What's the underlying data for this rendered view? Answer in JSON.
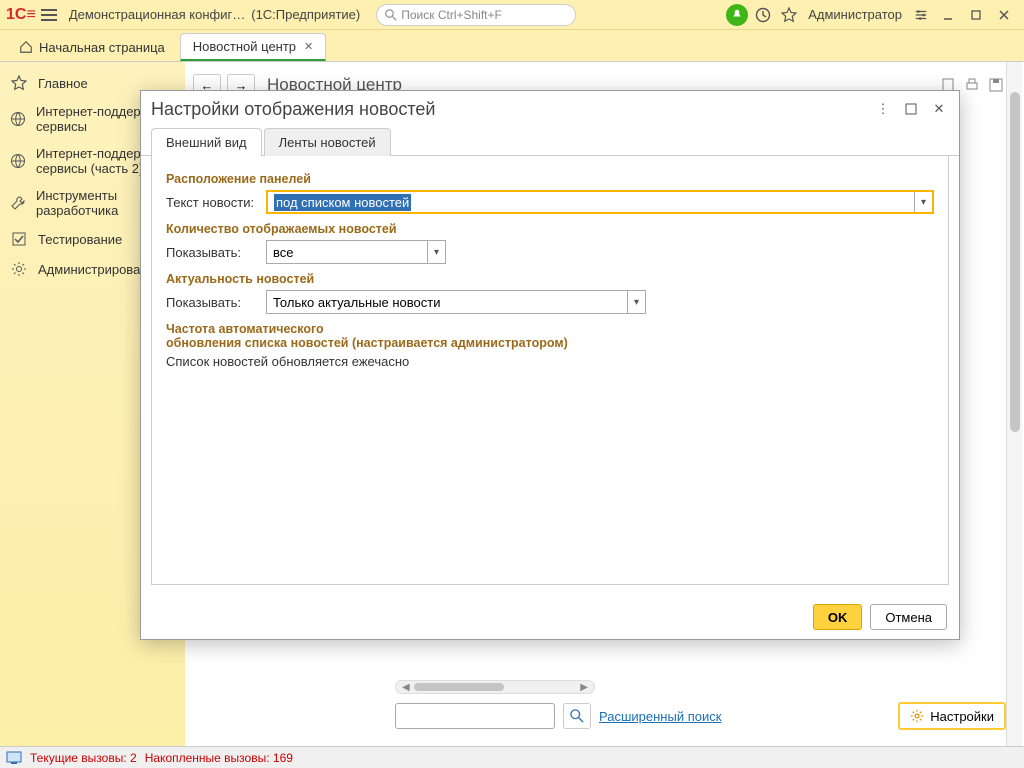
{
  "titlebar": {
    "app_name": "Демонстрационная конфиг…",
    "platform": "(1С:Предприятие)",
    "search_placeholder": "Поиск Ctrl+Shift+F",
    "user": "Администратор"
  },
  "tabs": {
    "home": "Начальная страница",
    "news": "Новостной центр"
  },
  "sidebar": [
    "Главное",
    "Интернет-поддержка и сервисы",
    "Интернет-поддержка и сервисы (часть 2)",
    "Инструменты разработчика",
    "Тестирование",
    "Администрирование"
  ],
  "page": {
    "title": "Новостной центр"
  },
  "search": {
    "advanced": "Расширенный поиск",
    "settings": "Настройки"
  },
  "dialog": {
    "title": "Настройки отображения новостей",
    "tab_appearance": "Внешний вид",
    "tab_feeds": "Ленты новостей",
    "sec_layout": "Расположение панелей",
    "lbl_newstext": "Текст новости:",
    "val_newstext": "под списком новостей",
    "sec_count": "Количество отображаемых новостей",
    "lbl_show1": "Показывать:",
    "val_show1": "все",
    "sec_relevance": "Актуальность новостей",
    "lbl_show2": "Показывать:",
    "val_show2": "Только актуальные новости",
    "sec_freq_l1": "Частота автоматического",
    "sec_freq_l2": "обновления списка новостей (настраивается администратором)",
    "freq_text": "Список новостей обновляется ежечасно",
    "ok": "OK",
    "cancel": "Отмена"
  },
  "status": {
    "calls_current_label": "Текущие вызовы:",
    "calls_current": "2",
    "calls_total_label": "Накопленные вызовы:",
    "calls_total": "169"
  }
}
